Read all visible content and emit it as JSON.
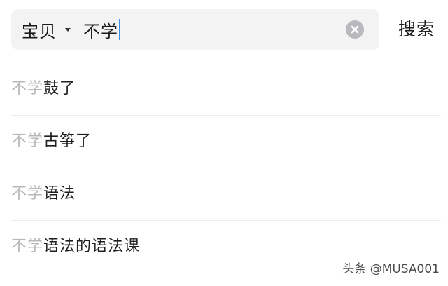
{
  "search": {
    "scope_label": "宝贝",
    "query": "不学",
    "clear_icon": "clear-x-icon",
    "submit_label": "搜索"
  },
  "suggestions": [
    {
      "prefix": "不学",
      "rest": "鼓了"
    },
    {
      "prefix": "不学",
      "rest": "古筝了"
    },
    {
      "prefix": "不学",
      "rest": "语法"
    },
    {
      "prefix": "不学",
      "rest": "语法的语法课"
    }
  ],
  "watermark": "头条 @MUSA001",
  "colors": {
    "search_bg": "#f3f3f4",
    "cursor": "#3a8ee6",
    "prefix_text": "#b8b8b8",
    "divider": "#ececec"
  }
}
